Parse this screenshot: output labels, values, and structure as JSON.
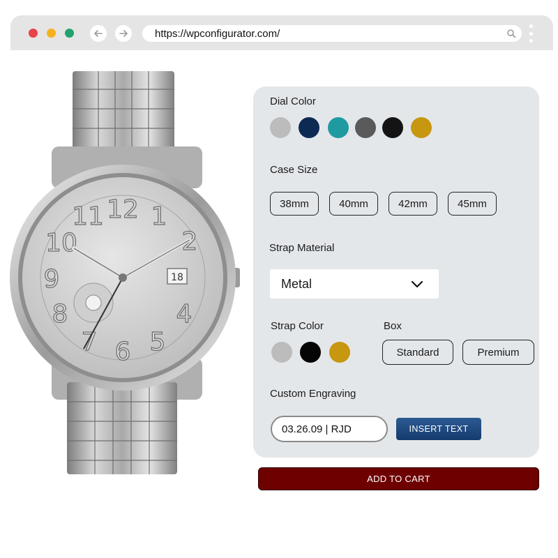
{
  "browser": {
    "url": "https://wpconfigurator.com/",
    "icons": [
      "close-dot",
      "minimize-dot",
      "maximize-dot",
      "back-arrow-icon",
      "forward-arrow-icon",
      "search-icon",
      "kebab-menu-icon"
    ]
  },
  "product": {
    "image": "silver-watch-image",
    "dial_date": "18"
  },
  "configurator": {
    "dial_color": {
      "label": "Dial Color",
      "swatches": [
        "#bcbcbc",
        "#0d2a52",
        "#1f9aa0",
        "#5a5a5a",
        "#141414",
        "#c6970f"
      ]
    },
    "case_size": {
      "label": "Case Size",
      "options": [
        "38mm",
        "40mm",
        "42mm",
        "45mm"
      ]
    },
    "strap_material": {
      "label": "Strap Material",
      "selected": "Metal"
    },
    "strap_color": {
      "label": "Strap Color",
      "swatches": [
        "#bcbcbc",
        "#050505",
        "#c6970f"
      ]
    },
    "box": {
      "label": "Box",
      "options": [
        "Standard",
        "Premium"
      ]
    },
    "engraving": {
      "label": "Custom Engraving",
      "value": "03.26.09 | RJD",
      "button": "INSERT TEXT"
    }
  },
  "cart": {
    "button": "ADD TO CART"
  }
}
